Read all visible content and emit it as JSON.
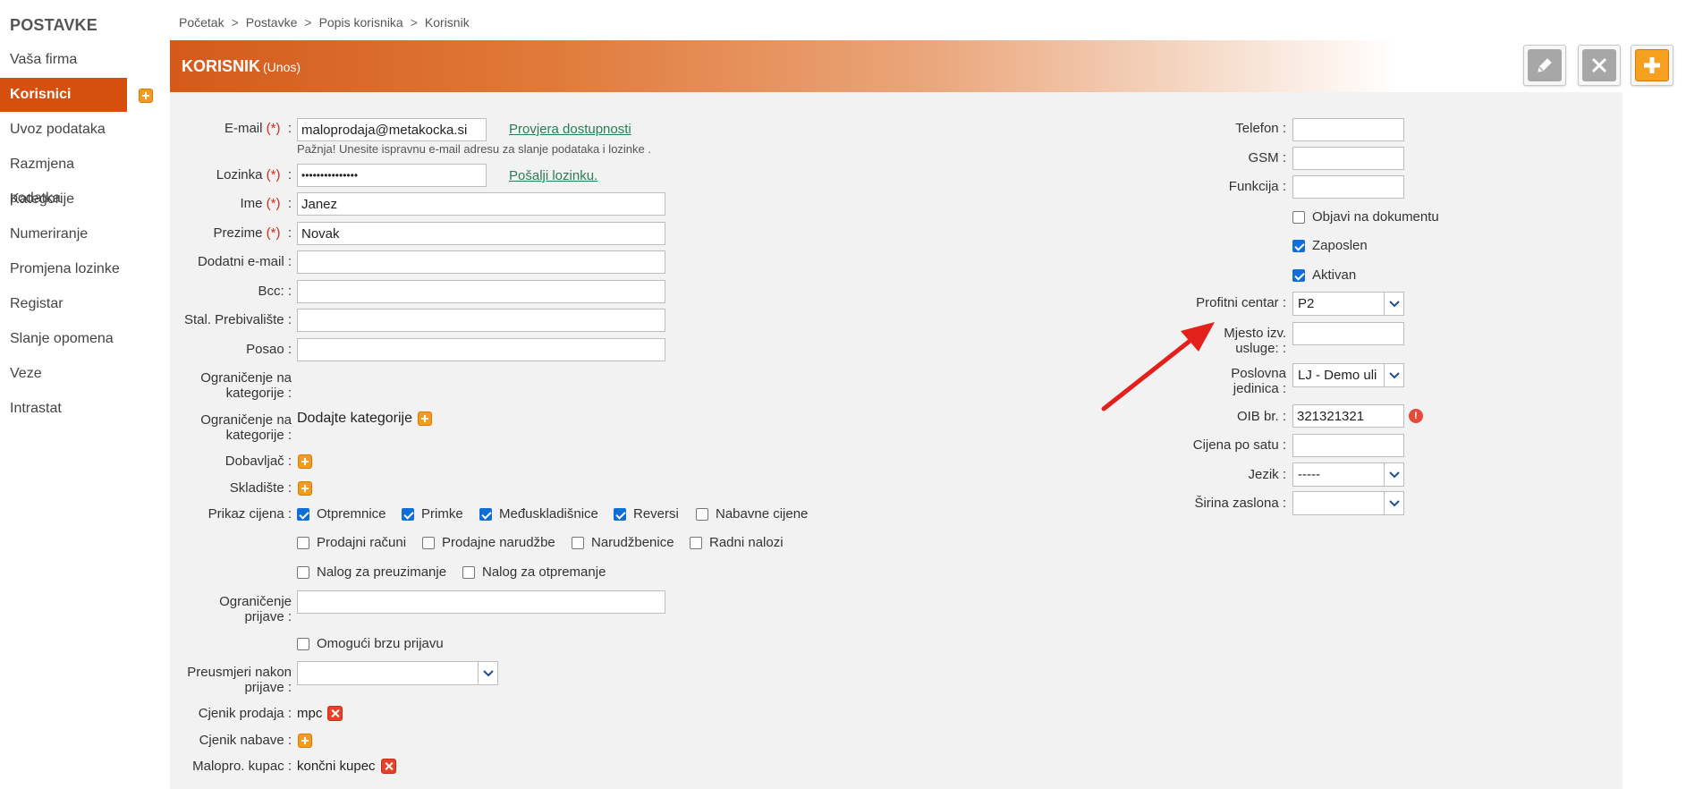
{
  "sidebar": {
    "title": "POSTAVKE",
    "items": [
      {
        "label": "Vaša firma"
      },
      {
        "label": "Korisnici"
      },
      {
        "label": "Uvoz podataka"
      },
      {
        "label": "Razmjena podatka"
      },
      {
        "label": "Kategorije"
      },
      {
        "label": "Numeriranje"
      },
      {
        "label": "Promjena lozinke"
      },
      {
        "label": "Registar"
      },
      {
        "label": "Slanje opomena"
      },
      {
        "label": "Veze"
      },
      {
        "label": "Intrastat"
      }
    ]
  },
  "breadcrumb": [
    "Početak",
    "Postavke",
    "Popis korisnika",
    "Korisnik"
  ],
  "breadcrumb_sep": ">",
  "header": {
    "title": "KORISNIK",
    "subtitle": "(Unos)"
  },
  "form_left": {
    "email_label": "E-mail",
    "required_mark": "(*)",
    "colon": ":",
    "email_value": "maloprodaja@metakocka.si",
    "email_check_link": "Provjera dostupnosti",
    "email_hint": "Pažnja! Unesite ispravnu e-mail adresu za slanje podataka i lozinke .",
    "password_label": "Lozinka",
    "password_value": "•••••••••••••••",
    "send_password_link": "Pošalji lozinku.",
    "name_label": "Ime",
    "name_value": "Janez",
    "surname_label": "Prezime",
    "surname_value": "Novak",
    "extra_email_label": "Dodatni e-mail :",
    "bcc_label": "Bcc: :",
    "residence_label": "Stal. Prebivalište :",
    "job_label": "Posao :",
    "cat_limit1_label": "Ograničenje na kategorije :",
    "cat_limit2_label": "Ograničenje na kategorije :",
    "add_categories": "Dodajte kategorije",
    "supplier_label": "Dobavljač :",
    "warehouse_label": "Skladište :",
    "price_display_label": "Prikaz cijena :",
    "price_checkboxes": [
      {
        "label": "Otpremnice",
        "checked": true
      },
      {
        "label": "Primke",
        "checked": true
      },
      {
        "label": "Međuskladišnice",
        "checked": true
      },
      {
        "label": "Reversi",
        "checked": true
      },
      {
        "label": "Nabavne cijene",
        "checked": false
      },
      {
        "label": "Prodajni računi",
        "checked": false
      },
      {
        "label": "Prodajne narudžbe",
        "checked": false
      },
      {
        "label": "Narudžbenice",
        "checked": false
      },
      {
        "label": "Radni nalozi",
        "checked": false
      },
      {
        "label": "Nalog za preuzimanje",
        "checked": false
      },
      {
        "label": "Nalog za otpremanje",
        "checked": false
      }
    ],
    "login_limit_label": "Ograničenje prijave :",
    "quick_login_label": "Omogući brzu prijavu",
    "redirect_label": "Preusmjeri nakon prijave :",
    "redirect_value": "",
    "sale_pricelist_label": "Cjenik prodaja :",
    "sale_pricelist_value": "mpc",
    "purchase_pricelist_label": "Cjenik nabave :",
    "retail_customer_label": "Malopro. kupac :",
    "retail_customer_value": "končni kupec"
  },
  "form_right": {
    "phone_label": "Telefon :",
    "gsm_label": "GSM :",
    "function_label": "Funkcija :",
    "publish_on_doc_label": "Objavi na dokumentu",
    "publish_on_doc_checked": false,
    "employed_label": "Zaposlen",
    "employed_checked": true,
    "active_label": "Aktivan",
    "active_checked": true,
    "profit_center_label": "Profitni centar :",
    "profit_center_value": "P2",
    "service_place_label": "Mjesto izv. usluge: :",
    "business_unit_label": "Poslovna jedinica :",
    "business_unit_value": "LJ - Demo ulic",
    "oib_label": "OIB br. :",
    "oib_value": "321321321",
    "hourly_price_label": "Cijena po satu :",
    "language_label": "Jezik :",
    "language_value": "-----",
    "screen_width_label": "Širina zaslona :",
    "screen_width_value": ""
  },
  "colors": {
    "accent": "#d5500e",
    "link": "#2a7d57",
    "required": "#d9281a",
    "checkbox": "#0f6fd7",
    "annotation_arrow": "#e3201b"
  }
}
